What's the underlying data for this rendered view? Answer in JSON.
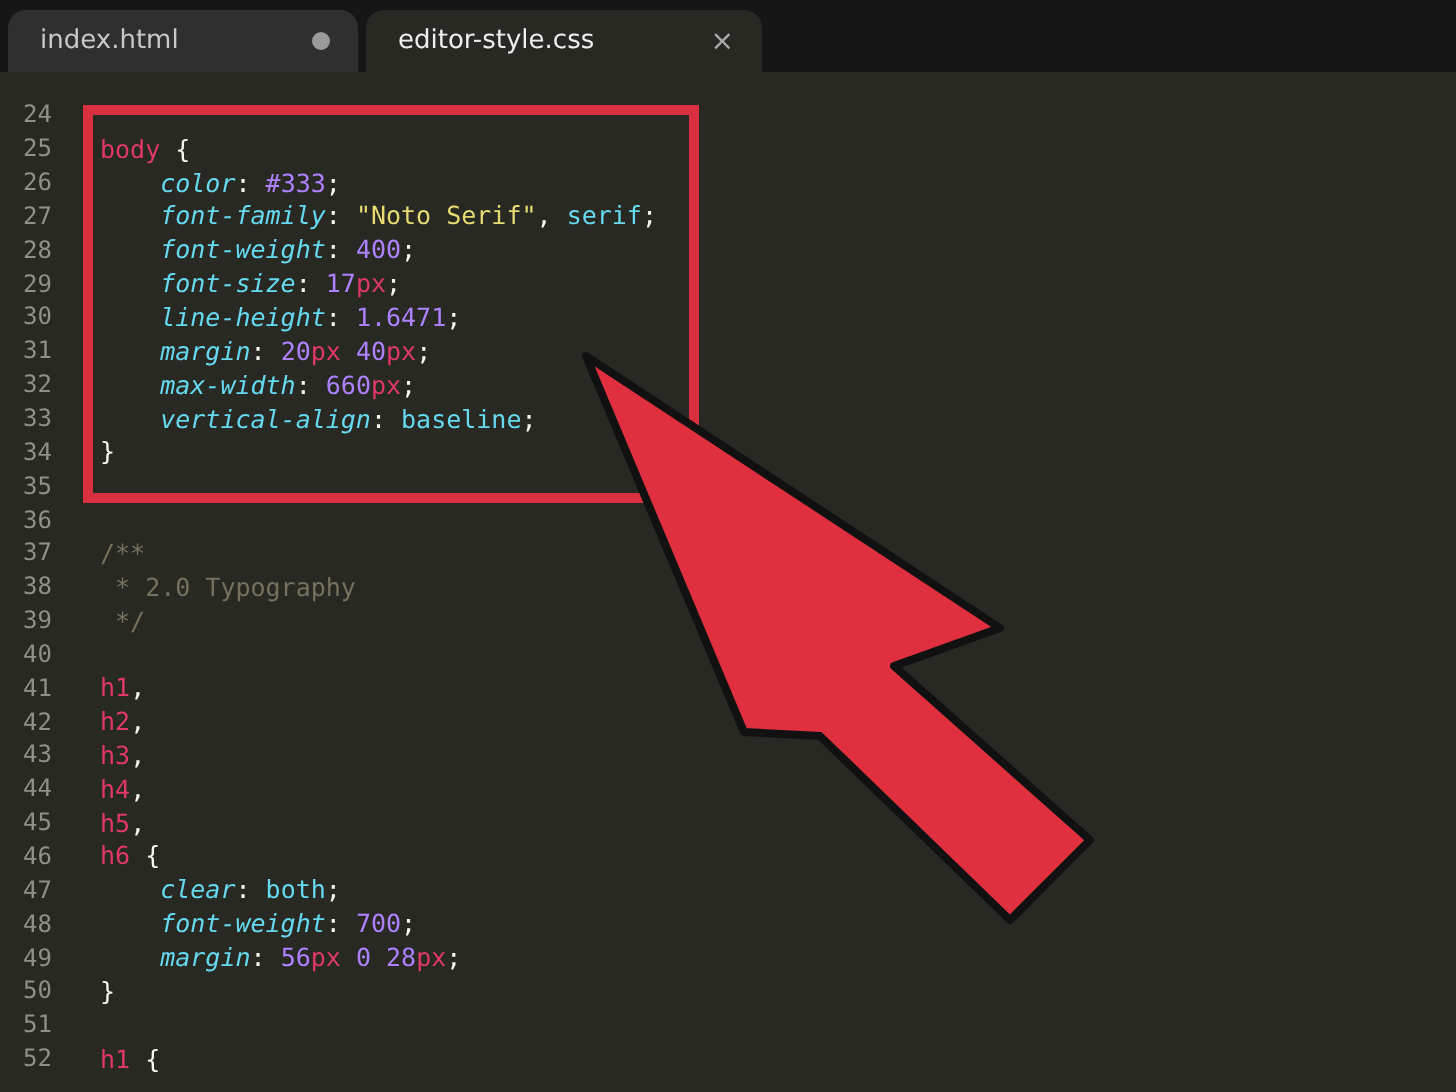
{
  "tabs": [
    {
      "label": "index.html",
      "selected": false,
      "modified": true
    },
    {
      "label": "editor-style.css",
      "selected": true,
      "modified": false,
      "close": "×"
    }
  ],
  "editor": {
    "lines": [
      {
        "number": "24"
      },
      {
        "number": "25",
        "tokens": [
          {
            "kind": "selector",
            "text": "body"
          },
          {
            "kind": "punct",
            "text": " {"
          }
        ]
      },
      {
        "number": "26",
        "tokens": [
          {
            "kind": "property",
            "text": "    color"
          },
          {
            "kind": "punct",
            "text": ": "
          },
          {
            "kind": "number",
            "text": "#333"
          },
          {
            "kind": "punct",
            "text": ";"
          }
        ]
      },
      {
        "number": "27",
        "tokens": [
          {
            "kind": "property",
            "text": "    font-family"
          },
          {
            "kind": "punct",
            "text": ": "
          },
          {
            "kind": "string",
            "text": "\"Noto Serif\""
          },
          {
            "kind": "punct",
            "text": ", "
          },
          {
            "kind": "value",
            "text": "serif"
          },
          {
            "kind": "punct",
            "text": ";"
          }
        ]
      },
      {
        "number": "28",
        "tokens": [
          {
            "kind": "property",
            "text": "    font-weight"
          },
          {
            "kind": "punct",
            "text": ": "
          },
          {
            "kind": "number",
            "text": "400"
          },
          {
            "kind": "punct",
            "text": ";"
          }
        ]
      },
      {
        "number": "29",
        "tokens": [
          {
            "kind": "property",
            "text": "    font-size"
          },
          {
            "kind": "punct",
            "text": ": "
          },
          {
            "kind": "number",
            "text": "17"
          },
          {
            "kind": "unit",
            "text": "px"
          },
          {
            "kind": "punct",
            "text": ";"
          }
        ]
      },
      {
        "number": "30",
        "tokens": [
          {
            "kind": "property",
            "text": "    line-height"
          },
          {
            "kind": "punct",
            "text": ": "
          },
          {
            "kind": "number",
            "text": "1.6471"
          },
          {
            "kind": "punct",
            "text": ";"
          }
        ]
      },
      {
        "number": "31",
        "tokens": [
          {
            "kind": "property",
            "text": "    margin"
          },
          {
            "kind": "punct",
            "text": ": "
          },
          {
            "kind": "number",
            "text": "20"
          },
          {
            "kind": "unit",
            "text": "px"
          },
          {
            "kind": "number",
            "text": " 40"
          },
          {
            "kind": "unit",
            "text": "px"
          },
          {
            "kind": "punct",
            "text": ";"
          }
        ]
      },
      {
        "number": "32",
        "tokens": [
          {
            "kind": "property",
            "text": "    max-width"
          },
          {
            "kind": "punct",
            "text": ": "
          },
          {
            "kind": "number",
            "text": "660"
          },
          {
            "kind": "unit",
            "text": "px"
          },
          {
            "kind": "punct",
            "text": ";"
          }
        ]
      },
      {
        "number": "33",
        "tokens": [
          {
            "kind": "property",
            "text": "    vertical-align"
          },
          {
            "kind": "punct",
            "text": ": "
          },
          {
            "kind": "value",
            "text": "baseline"
          },
          {
            "kind": "punct",
            "text": ";"
          }
        ]
      },
      {
        "number": "34",
        "tokens": [
          {
            "kind": "punct",
            "text": "}"
          }
        ]
      },
      {
        "number": "35"
      },
      {
        "number": "36"
      },
      {
        "number": "37",
        "tokens": [
          {
            "kind": "comment",
            "text": "/**"
          }
        ]
      },
      {
        "number": "38",
        "tokens": [
          {
            "kind": "comment",
            "text": " * 2.0 Typography"
          }
        ]
      },
      {
        "number": "39",
        "tokens": [
          {
            "kind": "comment",
            "text": " */"
          }
        ]
      },
      {
        "number": "40"
      },
      {
        "number": "41",
        "tokens": [
          {
            "kind": "selector",
            "text": "h1"
          },
          {
            "kind": "punct",
            "text": ","
          }
        ]
      },
      {
        "number": "42",
        "tokens": [
          {
            "kind": "selector",
            "text": "h2"
          },
          {
            "kind": "punct",
            "text": ","
          }
        ]
      },
      {
        "number": "43",
        "tokens": [
          {
            "kind": "selector",
            "text": "h3"
          },
          {
            "kind": "punct",
            "text": ","
          }
        ]
      },
      {
        "number": "44",
        "tokens": [
          {
            "kind": "selector",
            "text": "h4"
          },
          {
            "kind": "punct",
            "text": ","
          }
        ]
      },
      {
        "number": "45",
        "tokens": [
          {
            "kind": "selector",
            "text": "h5"
          },
          {
            "kind": "punct",
            "text": ","
          }
        ]
      },
      {
        "number": "46",
        "tokens": [
          {
            "kind": "selector",
            "text": "h6"
          },
          {
            "kind": "punct",
            "text": " {"
          }
        ]
      },
      {
        "number": "47",
        "tokens": [
          {
            "kind": "property",
            "text": "    clear"
          },
          {
            "kind": "punct",
            "text": ": "
          },
          {
            "kind": "value",
            "text": "both"
          },
          {
            "kind": "punct",
            "text": ";"
          }
        ]
      },
      {
        "number": "48",
        "tokens": [
          {
            "kind": "property",
            "text": "    font-weight"
          },
          {
            "kind": "punct",
            "text": ": "
          },
          {
            "kind": "number",
            "text": "700"
          },
          {
            "kind": "punct",
            "text": ";"
          }
        ]
      },
      {
        "number": "49",
        "tokens": [
          {
            "kind": "property",
            "text": "    margin"
          },
          {
            "kind": "punct",
            "text": ": "
          },
          {
            "kind": "number",
            "text": "56"
          },
          {
            "kind": "unit",
            "text": "px"
          },
          {
            "kind": "number",
            "text": " 0 28"
          },
          {
            "kind": "unit",
            "text": "px"
          },
          {
            "kind": "punct",
            "text": ";"
          }
        ]
      },
      {
        "number": "50",
        "tokens": [
          {
            "kind": "punct",
            "text": "}"
          }
        ]
      },
      {
        "number": "51"
      },
      {
        "number": "52",
        "tokens": [
          {
            "kind": "selector",
            "text": "h1"
          },
          {
            "kind": "punct",
            "text": " {"
          }
        ]
      }
    ]
  }
}
